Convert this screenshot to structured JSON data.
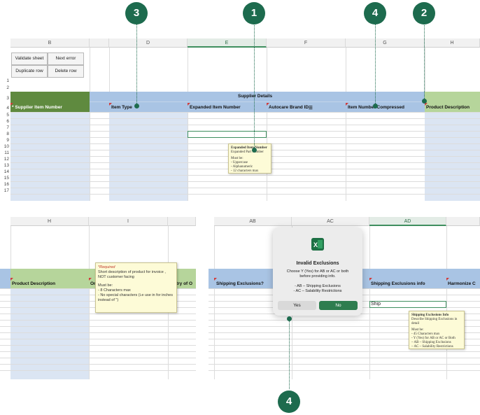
{
  "callouts": [
    "3",
    "1",
    "4",
    "2",
    "4"
  ],
  "top": {
    "col_headers": [
      "B",
      "D",
      "E",
      "F",
      "G",
      "H"
    ],
    "row_numbers": [
      "1",
      "2",
      "3",
      "4",
      "5",
      "6",
      "7",
      "8",
      "9",
      "10",
      "11",
      "12",
      "13",
      "14",
      "15",
      "16",
      "17"
    ],
    "buttons": [
      "Validate sheet",
      "Next error",
      "Duplicate row",
      "Delete row"
    ],
    "group_header": "Supplier Details",
    "headers": {
      "supplier_item_number": "* Supplier Item Number",
      "item_type": "Item Type",
      "expanded_item_number": "Expanded Item Number",
      "autocare_brand_id": "Autocare Brand ID",
      "filter_glyph": "☰",
      "item_number_compressed": "Item Number Compressed",
      "product_description": "Product Description"
    },
    "tooltip": {
      "title": "Expanded Item Number",
      "lines": [
        "Expanded Part Number",
        "",
        "Must be:",
        "- Uppercase",
        "- Alphanumeric",
        "- 12 characters max"
      ]
    }
  },
  "bottom_left": {
    "col_headers": [
      "H",
      "I"
    ],
    "header_product_description": "Product Description",
    "header_partial_1": "On",
    "header_partial_2": "ntry of O",
    "tooltip": {
      "required": "*Required",
      "lines": [
        "Short description of product for invoice ,",
        "NOT customer facing",
        "",
        "Must be:",
        "- 8 Characters max",
        "- No special characters (i.e use in for inches",
        "instead of \")"
      ]
    }
  },
  "bottom_right": {
    "col_headers": [
      "AB",
      "AC",
      "AD"
    ],
    "header_shipping_exclusions": "Shipping Exclusions?",
    "header_shipping_exclusions_info": "Shipping Exclusions info",
    "header_partial": "Harmonize C",
    "cell_value": "Ship",
    "dialog": {
      "title": "Invalid Exclusions",
      "message": [
        "Choose Y (Yes) for AB or AC or both",
        "before providing info.",
        "",
        "- AB – Shipping Exclusions",
        "- AC – Salability Restrictions"
      ],
      "yes_label": "Yes",
      "no_label": "No"
    },
    "tooltip": {
      "title": "Shipping Exclusions Info",
      "lines": [
        "Describe Shipping Exclusions in",
        "detail",
        "",
        "Must be:",
        "- 45 Characters max",
        "- Y (Yes) for AB or AC or Both",
        "   – AB – Shipping Exclusions",
        "   – AC – Salability Restrictions"
      ]
    }
  },
  "colors": {
    "callout": "#1d6b4e",
    "blue_header": "#a9c4e4",
    "blue_band": "#dbe5f3",
    "green_header": "#b6d59b",
    "dark_green_header": "#5f8a3f",
    "tooltip_bg": "#fdfbd7",
    "dialog_no": "#2e7d4f"
  }
}
